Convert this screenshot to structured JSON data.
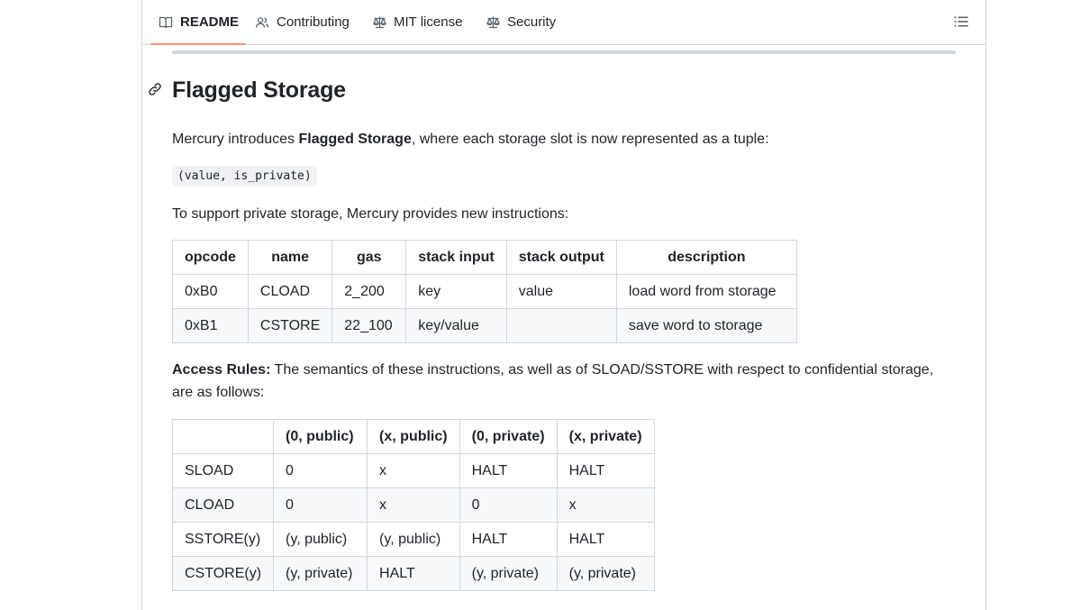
{
  "tabs": [
    {
      "label": "README",
      "icon": "book-icon",
      "active": true
    },
    {
      "label": "Contributing",
      "icon": "people-icon",
      "active": false
    },
    {
      "label": "MIT license",
      "icon": "law-icon",
      "active": false
    },
    {
      "label": "Security",
      "icon": "law-icon",
      "active": false
    }
  ],
  "toc_icon": "list-unordered-icon",
  "section": {
    "title": "Flagged Storage",
    "intro_before": "Mercury introduces ",
    "intro_bold": "Flagged Storage",
    "intro_after": ", where each storage slot is now represented as a tuple:",
    "code": "(value, is_private)",
    "instructions_text": "To support private storage, Mercury provides new instructions:",
    "access_bold": "Access Rules:",
    "access_text_line1": " The semantics of these instructions, as well as of SLOAD/SSTORE with respect to confidential storage,",
    "access_text_line2": "are as follows:"
  },
  "opcode_table": {
    "headers": [
      "opcode",
      "name",
      "gas",
      "stack input",
      "stack output",
      "description"
    ],
    "rows": [
      [
        "0xB0",
        "CLOAD",
        "2_200",
        "key",
        "value",
        "load word from storage"
      ],
      [
        "0xB1",
        "CSTORE",
        "22_100",
        "key/value",
        "",
        "save word to storage"
      ]
    ]
  },
  "rules_table": {
    "headers": [
      "",
      "(0, public)",
      "(x, public)",
      "(0, private)",
      "(x, private)"
    ],
    "rows": [
      [
        "SLOAD",
        "0",
        "x",
        "HALT",
        "HALT"
      ],
      [
        "CLOAD",
        "0",
        "x",
        "0",
        "x"
      ],
      [
        "SSTORE(y)",
        "(y, public)",
        "(y, public)",
        "HALT",
        "HALT"
      ],
      [
        "CSTORE(y)",
        "(y, private)",
        "HALT",
        "(y, private)",
        "(y, private)"
      ]
    ]
  }
}
